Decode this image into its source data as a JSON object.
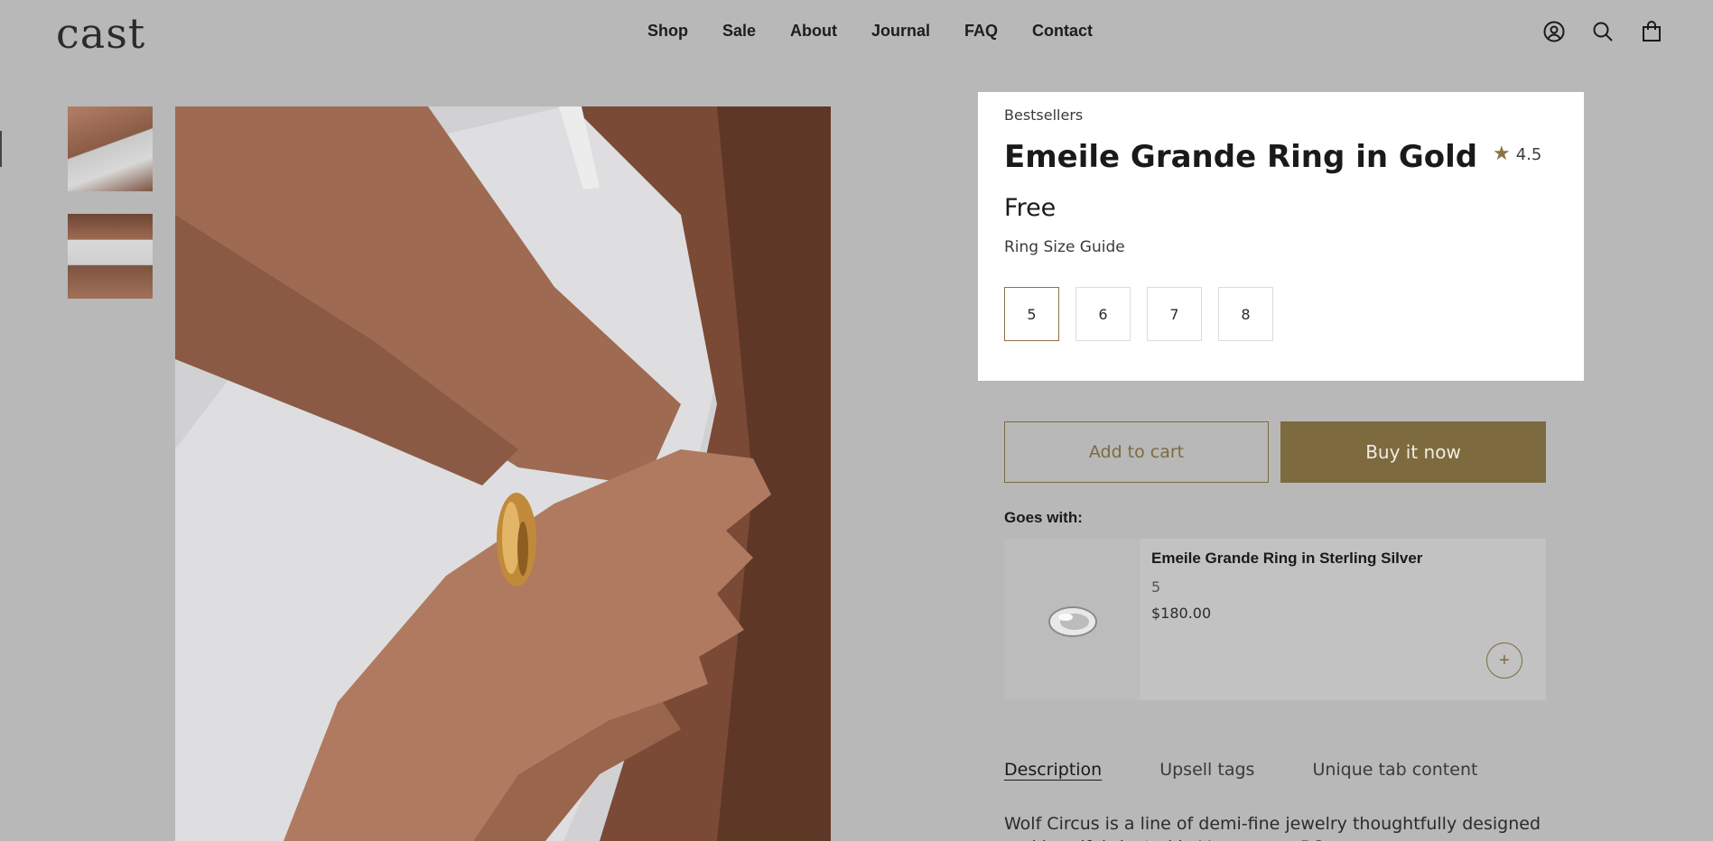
{
  "header": {
    "logo": "cast",
    "nav": [
      "Shop",
      "Sale",
      "About",
      "Journal",
      "FAQ",
      "Contact"
    ],
    "icons": [
      "account-icon",
      "search-icon",
      "cart-icon"
    ]
  },
  "product": {
    "collection": "Bestsellers",
    "title": "Emeile Grande Ring in Gold",
    "rating": "4.5",
    "price": "Free",
    "size_guide": "Ring Size Guide",
    "sizes": [
      "5",
      "6",
      "7",
      "8"
    ],
    "selected_size": "5",
    "add_to_cart": "Add to cart",
    "buy_now": "Buy it now"
  },
  "goes_with": {
    "label": "Goes with:",
    "item": {
      "title": "Emeile Grande Ring in Sterling Silver",
      "variant": "5",
      "price": "$180.00",
      "add": "+"
    }
  },
  "tabs": [
    "Description",
    "Upsell tags",
    "Unique tab content"
  ],
  "description": "Wolf Circus is a line of demi-fine jewelry thoughtfully designed and handfabricated in Vancouver, BC.",
  "colors": {
    "accent": "#7d6a3f",
    "page_bg": "#b8b8b8",
    "card_bg": "#ffffff"
  }
}
